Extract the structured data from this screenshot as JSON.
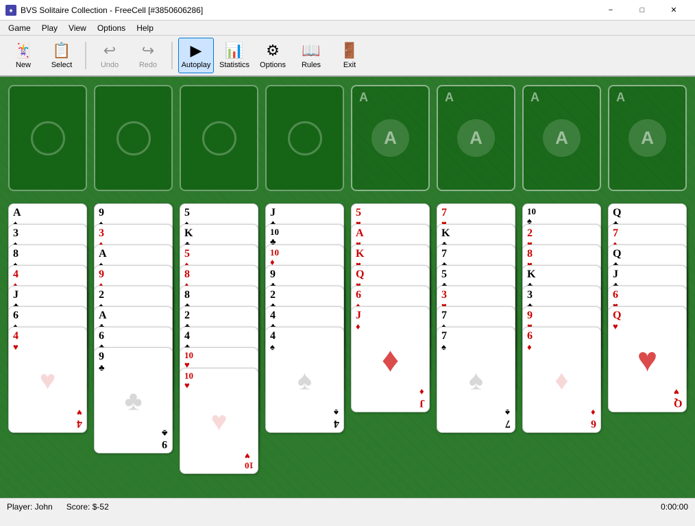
{
  "window": {
    "title": "BVS Solitaire Collection - FreeCell [#3850606286]",
    "icon": "♠"
  },
  "menubar": {
    "items": [
      "Game",
      "Play",
      "View",
      "Options",
      "Help"
    ]
  },
  "toolbar": {
    "buttons": [
      {
        "id": "new",
        "label": "New",
        "icon": "🃏",
        "active": false,
        "disabled": false
      },
      {
        "id": "select",
        "label": "Select",
        "icon": "📋",
        "active": false,
        "disabled": false
      },
      {
        "id": "undo",
        "label": "Undo",
        "icon": "↩",
        "active": false,
        "disabled": true
      },
      {
        "id": "redo",
        "label": "Redo",
        "icon": "↪",
        "active": false,
        "disabled": true
      },
      {
        "id": "autoplay",
        "label": "Autoplay",
        "icon": "▶",
        "active": true,
        "disabled": false
      },
      {
        "id": "statistics",
        "label": "Statistics",
        "icon": "📊",
        "active": false,
        "disabled": false
      },
      {
        "id": "options",
        "label": "Options",
        "icon": "⚙",
        "active": false,
        "disabled": false
      },
      {
        "id": "rules",
        "label": "Rules",
        "icon": "📖",
        "active": false,
        "disabled": false
      },
      {
        "id": "exit",
        "label": "Exit",
        "icon": "🚪",
        "active": false,
        "disabled": false
      }
    ]
  },
  "statusbar": {
    "player": "Player: John",
    "score": "Score: $-52",
    "time": "0:00:00"
  },
  "freecells": [
    {
      "empty": true
    },
    {
      "empty": true
    },
    {
      "empty": true
    },
    {
      "empty": true
    }
  ],
  "foundations": [
    {
      "label": "A",
      "empty": true
    },
    {
      "label": "A",
      "empty": true
    },
    {
      "label": "A",
      "empty": true
    },
    {
      "label": "A",
      "empty": true
    }
  ],
  "columns": [
    {
      "cards": [
        {
          "rank": "A",
          "suit": "♠",
          "color": "black"
        },
        {
          "rank": "3",
          "suit": "♠",
          "color": "black"
        },
        {
          "rank": "8",
          "suit": "♠",
          "color": "black"
        },
        {
          "rank": "4",
          "suit": "♦",
          "color": "red"
        },
        {
          "rank": "J",
          "suit": "♣",
          "color": "black",
          "face": true
        },
        {
          "rank": "6",
          "suit": "♠",
          "color": "black"
        },
        {
          "rank": "4",
          "suit": "♥",
          "color": "red"
        }
      ]
    },
    {
      "cards": [
        {
          "rank": "9",
          "suit": "♠",
          "color": "black"
        },
        {
          "rank": "3",
          "suit": "♦",
          "color": "red"
        },
        {
          "rank": "A",
          "suit": "♠",
          "color": "black"
        },
        {
          "rank": "9",
          "suit": "♦",
          "color": "red"
        },
        {
          "rank": "2",
          "suit": "♠",
          "color": "black"
        },
        {
          "rank": "A",
          "suit": "♣",
          "color": "black"
        },
        {
          "rank": "6",
          "suit": "♣",
          "color": "black"
        },
        {
          "rank": "9",
          "suit": "♣",
          "color": "black"
        }
      ]
    },
    {
      "cards": [
        {
          "rank": "5",
          "suit": "♠",
          "color": "black"
        },
        {
          "rank": "K",
          "suit": "♣",
          "color": "black",
          "face": true
        },
        {
          "rank": "5",
          "suit": "♦",
          "color": "red"
        },
        {
          "rank": "8",
          "suit": "♦",
          "color": "red"
        },
        {
          "rank": "8",
          "suit": "♣",
          "color": "black"
        },
        {
          "rank": "2",
          "suit": "♣",
          "color": "black"
        },
        {
          "rank": "4",
          "suit": "♣",
          "color": "black"
        },
        {
          "rank": "10",
          "suit": "♥",
          "color": "red"
        },
        {
          "rank": "10",
          "suit": "♥",
          "color": "red"
        }
      ]
    },
    {
      "cards": [
        {
          "rank": "J",
          "suit": "♣",
          "color": "black",
          "face": true
        },
        {
          "rank": "10",
          "suit": "♣",
          "color": "black"
        },
        {
          "rank": "10",
          "suit": "♦",
          "color": "red"
        },
        {
          "rank": "9",
          "suit": "♣",
          "color": "black"
        },
        {
          "rank": "2",
          "suit": "♣",
          "color": "black"
        },
        {
          "rank": "4",
          "suit": "♣",
          "color": "black"
        },
        {
          "rank": "4",
          "suit": "♠",
          "color": "black"
        }
      ]
    },
    {
      "cards": [
        {
          "rank": "5",
          "suit": "♥",
          "color": "red"
        },
        {
          "rank": "A",
          "suit": "♥",
          "color": "red"
        },
        {
          "rank": "K",
          "suit": "♥",
          "color": "red",
          "face": true
        },
        {
          "rank": "Q",
          "suit": "♥",
          "color": "red",
          "face": true
        },
        {
          "rank": "6",
          "suit": "♦",
          "color": "red"
        },
        {
          "rank": "J",
          "suit": "♦",
          "color": "red",
          "face": true
        }
      ]
    },
    {
      "cards": [
        {
          "rank": "7",
          "suit": "♥",
          "color": "red"
        },
        {
          "rank": "K",
          "suit": "♣",
          "color": "black",
          "face": true
        },
        {
          "rank": "7",
          "suit": "♣",
          "color": "black"
        },
        {
          "rank": "5",
          "suit": "♣",
          "color": "black"
        },
        {
          "rank": "3",
          "suit": "♥",
          "color": "red"
        },
        {
          "rank": "7",
          "suit": "♠",
          "color": "black"
        },
        {
          "rank": "7",
          "suit": "♠",
          "color": "black"
        }
      ]
    },
    {
      "cards": [
        {
          "rank": "10",
          "suit": "♠",
          "color": "black"
        },
        {
          "rank": "2",
          "suit": "♥",
          "color": "red"
        },
        {
          "rank": "8",
          "suit": "♥",
          "color": "red"
        },
        {
          "rank": "K",
          "suit": "♣",
          "color": "black",
          "face": true
        },
        {
          "rank": "3",
          "suit": "♣",
          "color": "black"
        },
        {
          "rank": "9",
          "suit": "♥",
          "color": "red"
        },
        {
          "rank": "6",
          "suit": "♦",
          "color": "red"
        }
      ]
    },
    {
      "cards": [
        {
          "rank": "Q",
          "suit": "♣",
          "color": "black",
          "face": true
        },
        {
          "rank": "7",
          "suit": "♦",
          "color": "red"
        },
        {
          "rank": "Q",
          "suit": "♣",
          "color": "black",
          "face": true
        },
        {
          "rank": "J",
          "suit": "♣",
          "color": "black"
        },
        {
          "rank": "6",
          "suit": "♥",
          "color": "red"
        },
        {
          "rank": "Q",
          "suit": "♥",
          "color": "red",
          "face": true
        }
      ]
    }
  ]
}
